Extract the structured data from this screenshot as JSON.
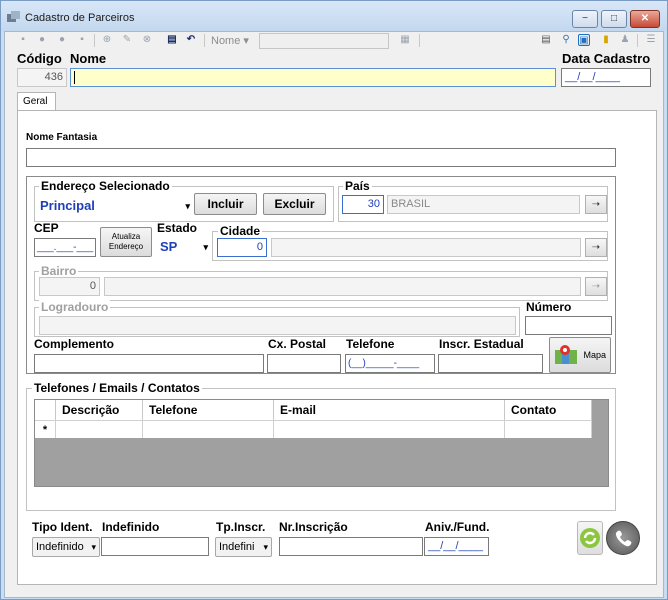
{
  "window": {
    "title": "Cadastro de Parceiros",
    "minimize": "−",
    "maximize": "□",
    "close": "✕"
  },
  "toolbar": {
    "nome_combo": "Nome"
  },
  "header": {
    "codigo_label": "Código",
    "codigo_value": "436",
    "nome_label": "Nome",
    "nome_value": "",
    "data_label": "Data Cadastro",
    "data_value": "__/__/____"
  },
  "tabs": [
    {
      "label": "Geral"
    }
  ],
  "form": {
    "nome_fantasia_label": "Nome Fantasia",
    "endereco_group": "Endereço Selecionado",
    "endereco_value": "Principal",
    "incluir": "Incluir",
    "excluir": "Excluir",
    "pais_label": "País",
    "pais_code": "30",
    "pais_name": "BRASIL",
    "cep_label": "CEP",
    "cep_value": "___.___-___",
    "atualiza_line1": "Atualiza",
    "atualiza_line2": "Endereço",
    "estado_label": "Estado",
    "estado_value": "SP",
    "cidade_label": "Cidade",
    "cidade_code": "0",
    "bairro_label": "Bairro",
    "bairro_code": "0",
    "logradouro_label": "Logradouro",
    "numero_label": "Número",
    "complemento_label": "Complemento",
    "cxpostal_label": "Cx. Postal",
    "telefone_label": "Telefone",
    "telefone_value": "(__)_____-____",
    "inscr_label": "Inscr. Estadual",
    "mapa": "Mapa"
  },
  "contacts": {
    "title": "Telefones / Emails / Contatos",
    "columns": [
      "Descrição",
      "Telefone",
      "E-mail",
      "Contato"
    ],
    "new_row_marker": "*"
  },
  "footer": {
    "tipo_ident_label": "Tipo Ident.",
    "tipo_ident_value": "Indefinido",
    "indefinido_label": "Indefinido",
    "tpinscr_label": "Tp.Inscr.",
    "tpinscr_value": "Indefini",
    "nrinscr_label": "Nr.Inscrição",
    "aniv_label": "Aniv./Fund.",
    "aniv_value": "__/__/____"
  },
  "colors": {
    "required_field": "#ffffcc",
    "title_bar": "#c9ddf1",
    "link_blue": "#1f3fb8"
  }
}
